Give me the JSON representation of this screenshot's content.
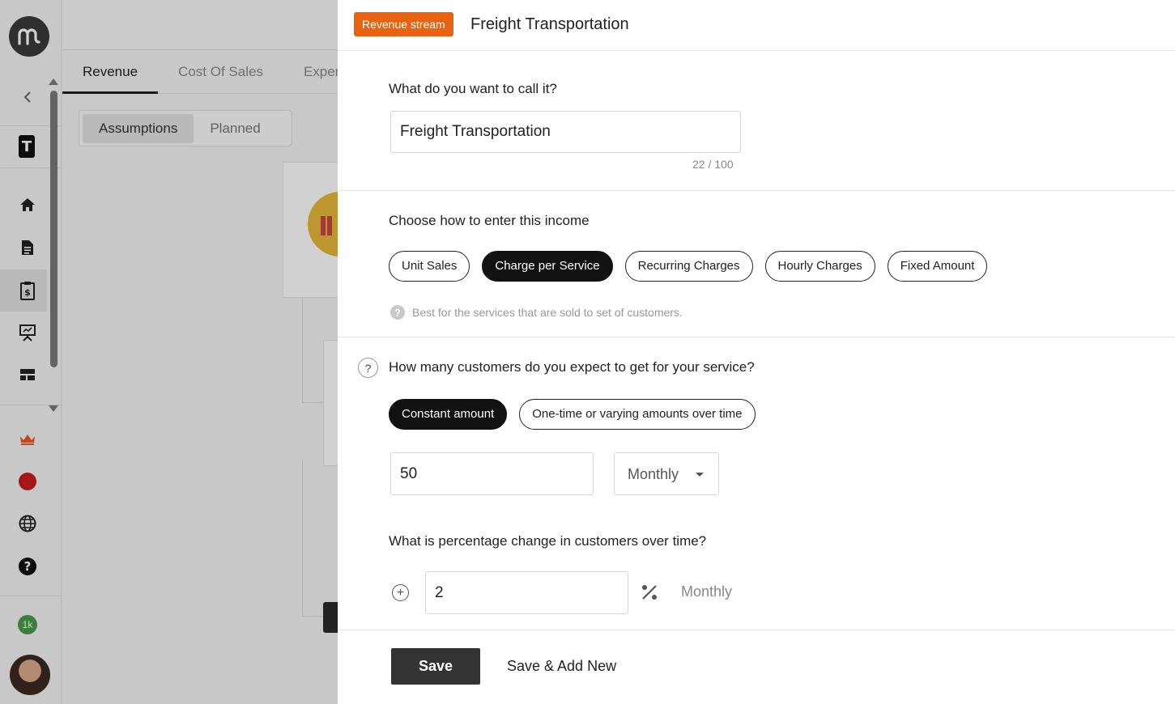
{
  "header": {
    "badge": "Revenue stream",
    "title": "Freight Transportation"
  },
  "name_section": {
    "question": "What do you want to call it?",
    "value": "Freight Transportation",
    "counter": "22 / 100"
  },
  "income_section": {
    "question": "Choose how to enter this income",
    "options": [
      "Unit Sales",
      "Charge per Service",
      "Recurring Charges",
      "Hourly Charges",
      "Fixed Amount"
    ],
    "selected": "Charge per Service",
    "hint": "Best for the services that are sold to set of customers."
  },
  "customers_section": {
    "help_glyph": "?",
    "question": "How many customers do you expect to get for your service?",
    "modes": [
      "Constant amount",
      "One-time or varying amounts over time"
    ],
    "selected_mode": "Constant amount",
    "amount": "50",
    "frequency": "Monthly"
  },
  "change_section": {
    "question": "What is percentage change in customers over time?",
    "value": "2",
    "frequency": "Monthly"
  },
  "footer": {
    "save": "Save",
    "save_add_new": "Save & Add New"
  },
  "background": {
    "tabs": [
      "Revenue",
      "Cost Of Sales",
      "Exper"
    ],
    "active_tab": "Revenue",
    "segments": [
      "Assumptions",
      "Planned"
    ],
    "active_segment": "Assumptions"
  },
  "rail": {
    "workspace_letter": "T",
    "credits_badge": "1k"
  },
  "colors": {
    "badge": "#e8620f",
    "primary_dark": "#111111",
    "crown": "#e85a2a",
    "status_dot": "#cc1f1f"
  }
}
